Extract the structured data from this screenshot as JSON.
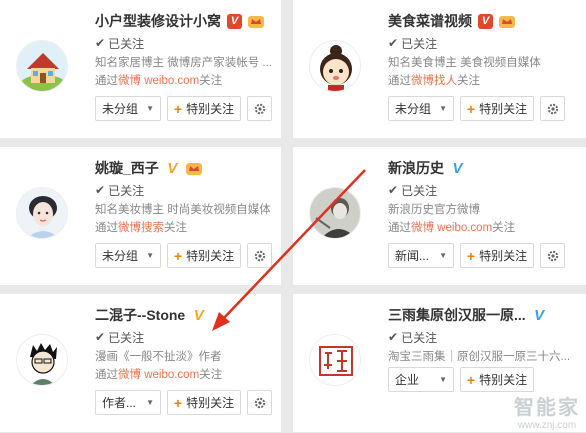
{
  "cards": [
    {
      "name": "小户型装修设计小窝",
      "badge": "V",
      "badge_color": "red",
      "followed": "已关注",
      "desc": "知名家居博主 微博房产家装帐号 ...",
      "via_prefix": "通过",
      "via_link": "微博 weibo.com",
      "via_suffix": "关注",
      "group": "未分组",
      "special": "特别关注"
    },
    {
      "name": "美食菜谱视频",
      "badge": "V",
      "badge_color": "red",
      "followed": "已关注",
      "desc": "知名美食博主 美食视频自媒体",
      "via_prefix": "通过",
      "via_link": "微博找人",
      "via_suffix": "关注",
      "group": "未分组",
      "special": "特别关注"
    },
    {
      "name": "姚璇_西子",
      "badge": "V",
      "badge_color": "gold",
      "followed": "已关注",
      "desc": "知名美妆博主 时尚美妆视频自媒体",
      "via_prefix": "通过",
      "via_link": "微博搜索",
      "via_suffix": "关注",
      "group": "未分组",
      "special": "特别关注"
    },
    {
      "name": "新浪历史",
      "badge": "V",
      "badge_color": "blue",
      "followed": "已关注",
      "desc": "新浪历史官方微博",
      "via_prefix": "通过",
      "via_link": "微博 weibo.com",
      "via_suffix": "关注",
      "group": "新闻...",
      "special": "特别关注"
    },
    {
      "name": "二混子--Stone",
      "badge": "V",
      "badge_color": "gold",
      "followed": "已关注",
      "desc": "漫画《一般不扯淡》作者",
      "via_prefix": "通过",
      "via_link": "微博 weibo.com",
      "via_suffix": "关注",
      "group": "作者...",
      "special": "特别关注"
    },
    {
      "name": "三雨集原创汉服一原...",
      "badge": "V",
      "badge_color": "blue",
      "followed": "已关注",
      "desc": "淘宝三雨集｜原创汉服一原三十六...",
      "via_prefix": "",
      "via_link": "",
      "via_suffix": "",
      "group": "企业",
      "special": "特别关注"
    }
  ],
  "icons": {
    "check": "check-icon",
    "plus": "plus-icon",
    "gear": "gear-icon",
    "caret": "caret-down-icon",
    "crown": "crown-icon"
  },
  "colors": {
    "link": "#eb7350",
    "plus": "#f08010",
    "arrow": "#e0301e"
  },
  "watermark": {
    "big": "智能家",
    "small": "www.znj.com"
  }
}
